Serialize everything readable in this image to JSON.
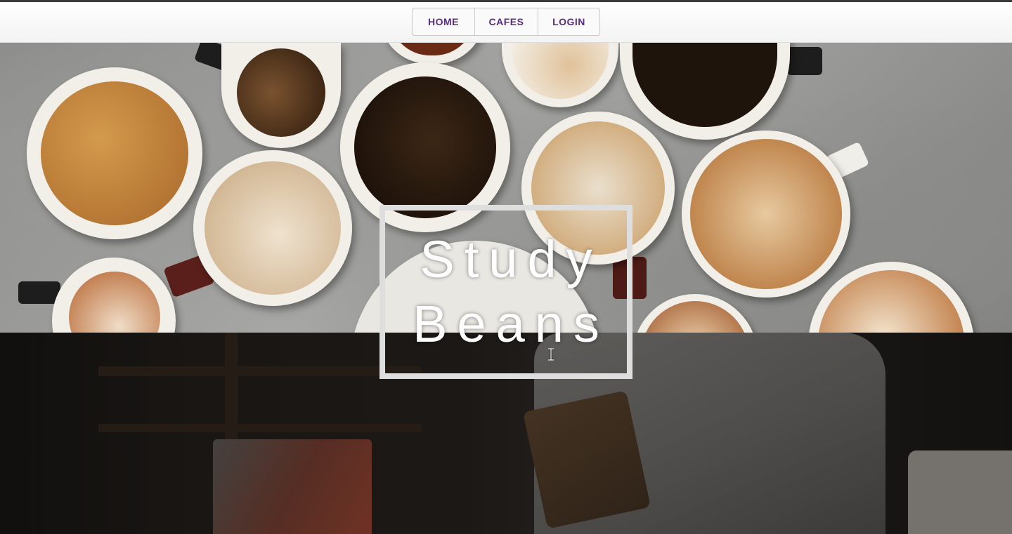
{
  "nav": {
    "items": [
      {
        "label": "HOME"
      },
      {
        "label": "CAFES"
      },
      {
        "label": "LOGIN"
      }
    ]
  },
  "hero": {
    "title_line1": "Study",
    "title_line2": "Beans"
  },
  "colors": {
    "nav_text": "#5b2c83",
    "title_border": "#dedede",
    "title_text": "#ffffff"
  },
  "icons": {
    "cursor": "text-cursor-icon"
  }
}
